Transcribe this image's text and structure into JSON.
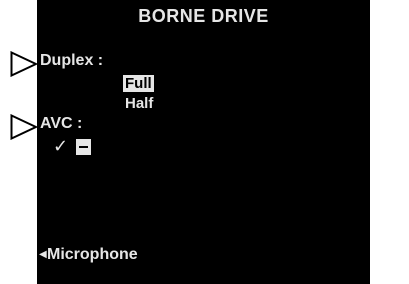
{
  "screen": {
    "title": "BORNE DRIVE",
    "title_faint": "",
    "duplex": {
      "label": "Duplex :",
      "options": [
        "Full",
        "Half"
      ],
      "selected": "Full"
    },
    "avc": {
      "label": "AVC :",
      "check_glyph": "✓",
      "checked": true
    },
    "microphone": {
      "arrow_glyph": "◀",
      "label": "Microphone"
    }
  },
  "pointers": {
    "icon": "pointer-triangle-icon",
    "color": "#000000"
  },
  "colors": {
    "screen_bg": "#000000",
    "text": "#e6e6e6",
    "highlight_bg": "#e6e6e6",
    "page_bg": "#ffffff"
  }
}
